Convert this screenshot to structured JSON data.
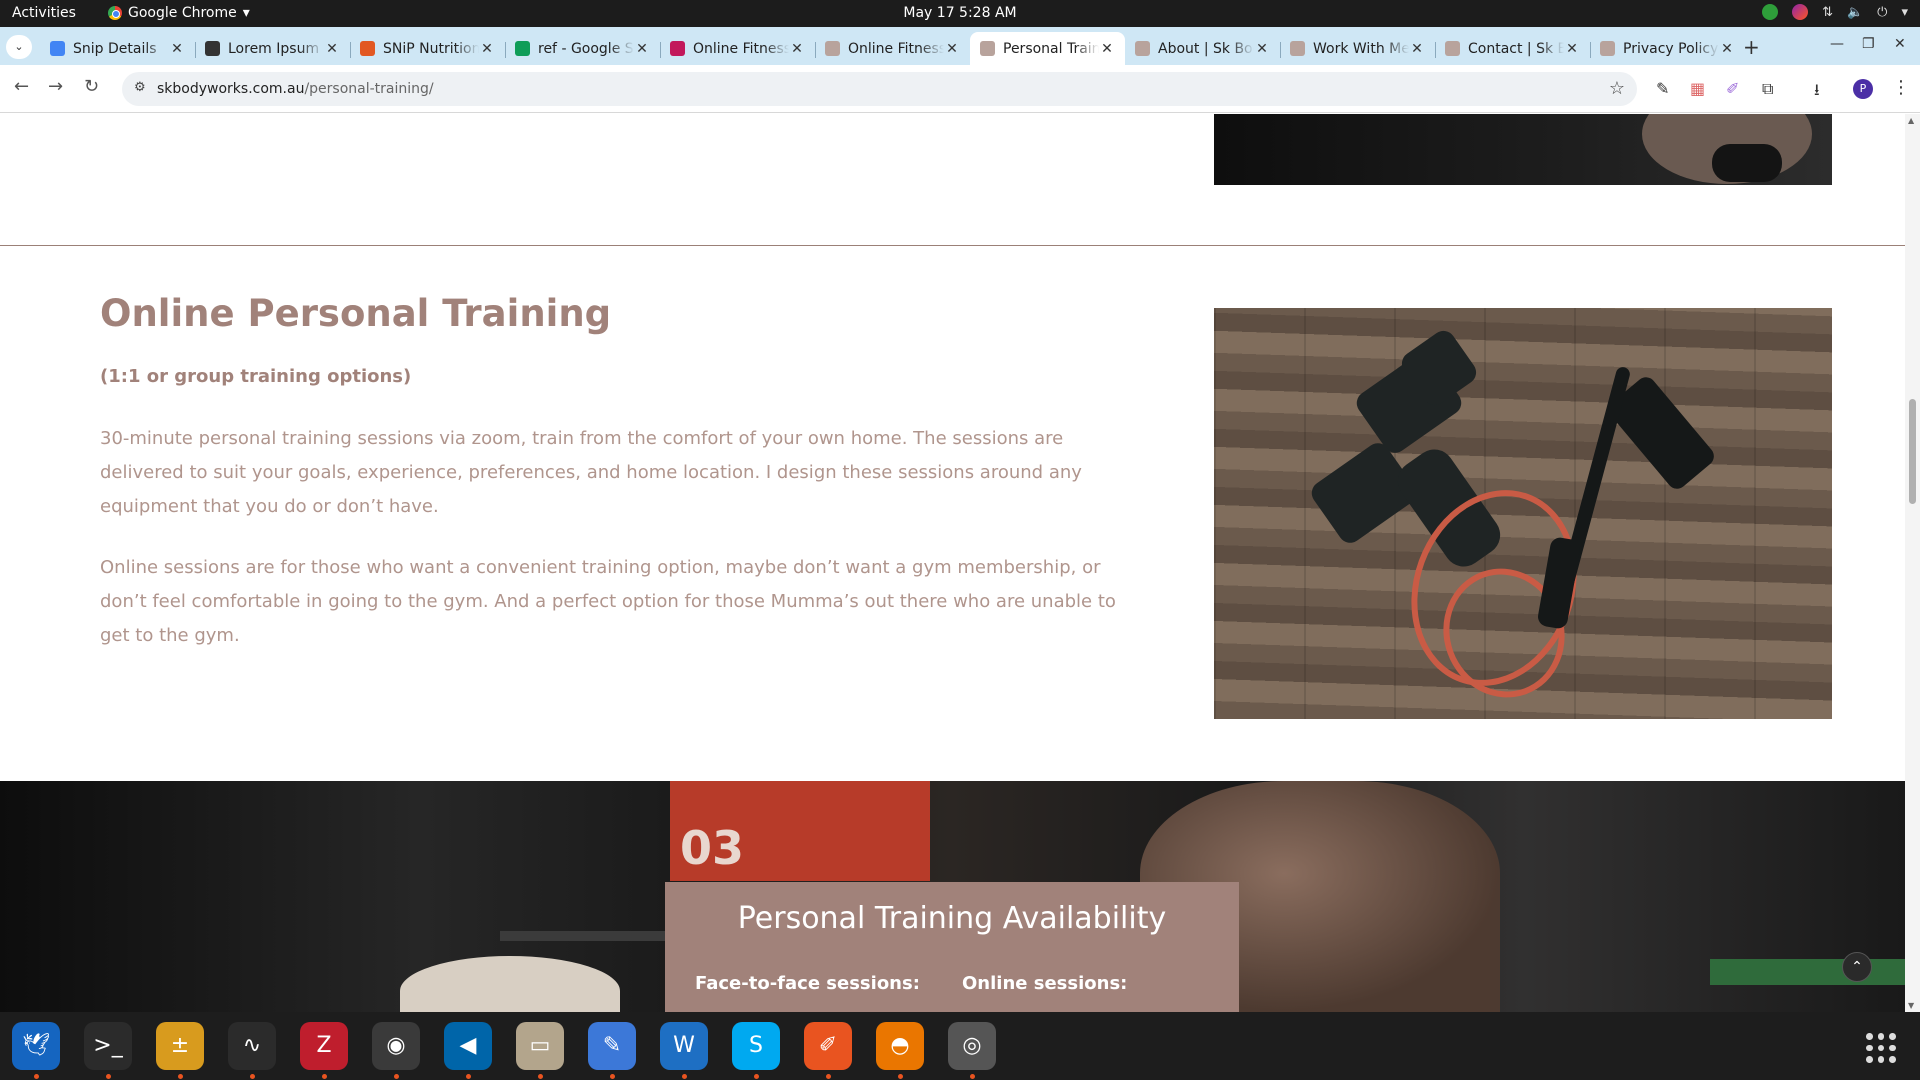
{
  "topbar": {
    "activities": "Activities",
    "app_name": "Google Chrome",
    "clock": "May 17  5:28 AM"
  },
  "tabs": [
    {
      "title": "Snip Details",
      "favicon": "docs-icon",
      "color": "#4285f4"
    },
    {
      "title": "Lorem Ipsum",
      "favicon": "lorem-icon",
      "color": "#333333"
    },
    {
      "title": "SNiP Nutrition",
      "favicon": "snip-icon",
      "color": "#e25822"
    },
    {
      "title": "ref - Google Sheets",
      "favicon": "sheets-icon",
      "color": "#0f9d58"
    },
    {
      "title": "Online Fitness",
      "favicon": "fitness-icon",
      "color": "#c2185b"
    },
    {
      "title": "Online Fitness",
      "favicon": "sk-icon",
      "color": "#b8a39c"
    },
    {
      "title": "Personal Training",
      "favicon": "sk-icon",
      "color": "#b8a39c",
      "active": true
    },
    {
      "title": "About | Sk Bodyworks",
      "favicon": "sk-icon",
      "color": "#b8a39c"
    },
    {
      "title": "Work With Me",
      "favicon": "sk-icon",
      "color": "#b8a39c"
    },
    {
      "title": "Contact | Sk Bodyworks",
      "favicon": "sk-icon",
      "color": "#b8a39c"
    },
    {
      "title": "Privacy Policy",
      "favicon": "sk-icon",
      "color": "#b8a39c"
    }
  ],
  "address_bar": {
    "domain": "skbodyworks.com.au",
    "path": "/personal-training/"
  },
  "page": {
    "heading": "Online Personal Training",
    "subheading": "(1:1 or group training options)",
    "paragraph1": "30-minute personal training sessions via zoom, train from the comfort of your own home. The sessions are delivered to suit your goals, experience, preferences, and home location. I design these sessions around any equipment that you do or don’t have.",
    "paragraph2": "Online sessions are for those who want a convenient training option, maybe don’t want a gym membership, or don’t feel comfortable in going to the gym. And a perfect option for those Mumma’s out there who are unable to get to the gym.",
    "availability": {
      "title": "Personal Training Availability",
      "col1": "Face-to-face sessions:",
      "col2": "Online sessions:"
    }
  },
  "colors": {
    "accent": "#a1827a",
    "text": "#b0958d",
    "tab_strip": "#cfe7f5"
  },
  "dock": [
    {
      "name": "thunderbird-icon"
    },
    {
      "name": "terminal-icon"
    },
    {
      "name": "calculator-icon"
    },
    {
      "name": "system-monitor-icon"
    },
    {
      "name": "filezilla-icon"
    },
    {
      "name": "chrome-icon",
      "active": true
    },
    {
      "name": "vscode-icon"
    },
    {
      "name": "files-icon"
    },
    {
      "name": "text-editor-icon"
    },
    {
      "name": "libreoffice-writer-icon"
    },
    {
      "name": "skype-icon"
    },
    {
      "name": "inkscape-icon"
    },
    {
      "name": "blender-icon"
    },
    {
      "name": "disk-icon"
    }
  ]
}
